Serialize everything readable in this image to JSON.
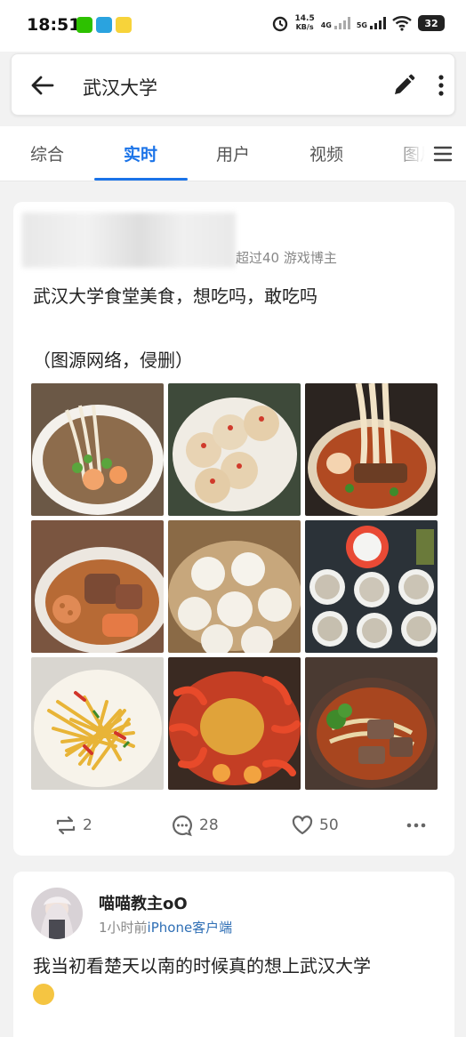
{
  "status_bar": {
    "time": "18:51",
    "net_speed_value": "14.5",
    "net_speed_unit": "KB/s",
    "net_4g": "4G",
    "net_5g": "5G",
    "battery": "32"
  },
  "search": {
    "query": "武汉大学"
  },
  "tabs": [
    {
      "label": "综合"
    },
    {
      "label": "实时"
    },
    {
      "label": "用户"
    },
    {
      "label": "视频"
    },
    {
      "label": "图片"
    }
  ],
  "post1": {
    "verified": "超过40 游戏博主",
    "text_line1": "武汉大学食堂美食，想吃吗，敢吃吗",
    "text_line2": "（图源网络，侵删）",
    "reposts": "2",
    "comments": "28",
    "likes": "50"
  },
  "post2": {
    "username": "喵喵教主oO",
    "time": "1小时前",
    "source": "iPhone客户端",
    "text": "我当初看楚天以南的时候真的想上武汉大学"
  },
  "colors": {
    "accent": "#1a73e8",
    "link": "#2f6fb5"
  }
}
